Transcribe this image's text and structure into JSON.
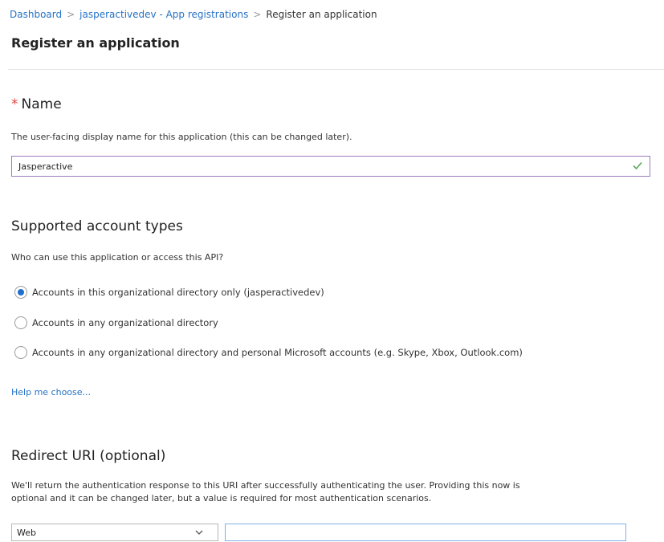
{
  "breadcrumb": {
    "items": [
      "Dashboard",
      "jasperactivedev - App registrations",
      "Register an application"
    ],
    "separator": ">"
  },
  "page": {
    "title": "Register an application"
  },
  "name_section": {
    "required_marker": "*",
    "title": "Name",
    "description": "The user-facing display name for this application (this can be changed later).",
    "input_value": "Jasperactive"
  },
  "account_types": {
    "title": "Supported account types",
    "question": "Who can use this application or access this API?",
    "options": [
      "Accounts in this organizational directory only (jasperactivedev)",
      "Accounts in any organizational directory",
      "Accounts in any organizational directory and personal Microsoft accounts (e.g. Skype, Xbox, Outlook.com)"
    ],
    "selected_index": 0,
    "help_link": "Help me choose..."
  },
  "redirect": {
    "title": "Redirect URI (optional)",
    "description_line1": "We'll return the authentication response to this URI after successfully authenticating the user. Providing this now is",
    "description_line2": "optional and it can be changed later, but a value is required for most authentication scenarios.",
    "platform_value": "Web",
    "uri_value": ""
  },
  "colors": {
    "link": "#2672c5",
    "required": "#e0443d",
    "valid_check": "#5ba55b",
    "radio_selected": "#1e6fce",
    "name_input_border": "#9b7cbf"
  },
  "icons": [
    "check-icon",
    "chevron-down-icon"
  ]
}
